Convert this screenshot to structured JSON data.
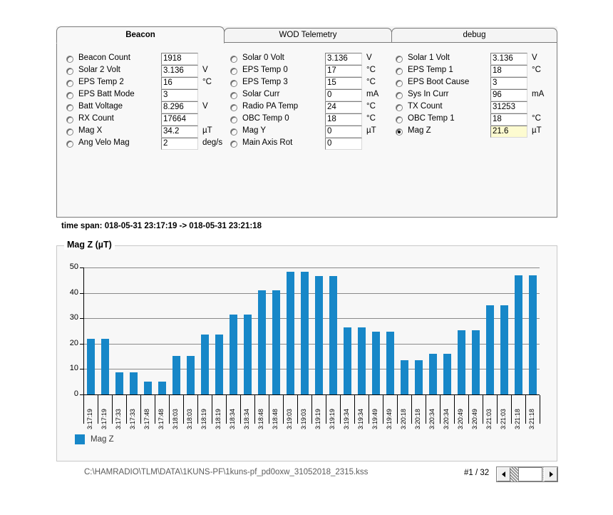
{
  "tabs": [
    {
      "label": "Beacon",
      "active": true
    },
    {
      "label": "WOD Telemetry",
      "active": false
    },
    {
      "label": "debug",
      "active": false
    }
  ],
  "form": {
    "columns": [
      {
        "rows": [
          {
            "label": "Beacon Count",
            "value": "1918",
            "unit": "",
            "selected": false,
            "highlight": false
          },
          {
            "label": "Solar 2 Volt",
            "value": "3.136",
            "unit": "V",
            "selected": false,
            "highlight": false
          },
          {
            "label": "EPS Temp 2",
            "value": "16",
            "unit": "°C",
            "selected": false,
            "highlight": false
          },
          {
            "label": "EPS Batt Mode",
            "value": "3",
            "unit": "",
            "selected": false,
            "highlight": false
          },
          {
            "label": "Batt Voltage",
            "value": "8.296",
            "unit": "V",
            "selected": false,
            "highlight": false
          },
          {
            "label": "RX Count",
            "value": "17664",
            "unit": "",
            "selected": false,
            "highlight": false
          },
          {
            "label": "Mag X",
            "value": "34.2",
            "unit": "µT",
            "selected": false,
            "highlight": false
          },
          {
            "label": "Ang Velo Mag",
            "value": "2",
            "unit": "deg/s",
            "selected": false,
            "highlight": false
          }
        ]
      },
      {
        "rows": [
          {
            "label": "Solar 0 Volt",
            "value": "3.136",
            "unit": "V",
            "selected": false,
            "highlight": false
          },
          {
            "label": "EPS Temp 0",
            "value": "17",
            "unit": "°C",
            "selected": false,
            "highlight": false
          },
          {
            "label": "EPS Temp 3",
            "value": "15",
            "unit": "°C",
            "selected": false,
            "highlight": false
          },
          {
            "label": "Solar Curr",
            "value": "0",
            "unit": "mA",
            "selected": false,
            "highlight": false
          },
          {
            "label": "Radio PA Temp",
            "value": "24",
            "unit": "°C",
            "selected": false,
            "highlight": false
          },
          {
            "label": "OBC Temp 0",
            "value": "18",
            "unit": "°C",
            "selected": false,
            "highlight": false
          },
          {
            "label": "Mag Y",
            "value": "0",
            "unit": "µT",
            "selected": false,
            "highlight": false
          },
          {
            "label": "Main Axis Rot",
            "value": "0",
            "unit": "",
            "selected": false,
            "highlight": false
          }
        ]
      },
      {
        "rows": [
          {
            "label": "Solar 1 Volt",
            "value": "3.136",
            "unit": "V",
            "selected": false,
            "highlight": false
          },
          {
            "label": "EPS Temp 1",
            "value": "18",
            "unit": "°C",
            "selected": false,
            "highlight": false
          },
          {
            "label": "EPS Boot Cause",
            "value": "3",
            "unit": "",
            "selected": false,
            "highlight": false
          },
          {
            "label": "Sys In Curr",
            "value": "96",
            "unit": "mA",
            "selected": false,
            "highlight": false
          },
          {
            "label": "TX Count",
            "value": "31253",
            "unit": "",
            "selected": false,
            "highlight": false
          },
          {
            "label": "OBC Temp 1",
            "value": "18",
            "unit": "°C",
            "selected": false,
            "highlight": false
          },
          {
            "label": "Mag Z",
            "value": "21.6",
            "unit": "µT",
            "selected": true,
            "highlight": true
          }
        ]
      }
    ]
  },
  "timespan": "time span: 018-05-31 23:17:19 -> 018-05-31 23:21:18",
  "chart_data": {
    "type": "bar",
    "title": "Mag Z (µT)",
    "xlabel": "",
    "ylabel": "",
    "ylim": [
      0,
      50
    ],
    "yticks": [
      0,
      10,
      20,
      30,
      40,
      50
    ],
    "grid": true,
    "legend_position": "bottom-left",
    "series": [
      {
        "name": "Mag Z",
        "color": "#1787c8",
        "values": [
          21.8,
          21.8,
          8.8,
          8.8,
          5.2,
          5.2,
          15.2,
          15.2,
          23.6,
          23.6,
          31.4,
          31.4,
          41.0,
          41.0,
          48.2,
          48.2,
          46.6,
          46.6,
          26.5,
          26.5,
          24.6,
          24.6,
          13.5,
          13.5,
          16.1,
          16.1,
          25.4,
          25.4,
          35.2,
          35.2,
          46.8,
          46.8
        ]
      }
    ],
    "categories": [
      "3:17:19",
      "3:17:19",
      "3:17:33",
      "3:17:33",
      "3:17:48",
      "3:17:48",
      "3:18:03",
      "3:18:03",
      "3:18:19",
      "3:18:19",
      "3:18:34",
      "3:18:34",
      "3:18:48",
      "3:18:48",
      "3:19:03",
      "3:19:03",
      "3:19:19",
      "3:19:19",
      "3:19:34",
      "3:19:34",
      "3:19:49",
      "3:19:49",
      "3:20:18",
      "3:20:18",
      "3:20:34",
      "3:20:34",
      "3:20:49",
      "3:20:49",
      "3:21:03",
      "3:21:03",
      "3:21:18",
      "3:21:18"
    ]
  },
  "legend": {
    "label": "Mag Z",
    "color": "#1787c8"
  },
  "footer": {
    "filepath": "C:\\HAMRADIO\\TLM\\DATA\\1KUNS-PF\\1kuns-pf_pd0oxw_31052018_2315.kss",
    "page": "#1 / 32",
    "scroll_left_icon": "triangle-left-icon",
    "scroll_right_icon": "triangle-right-icon"
  }
}
